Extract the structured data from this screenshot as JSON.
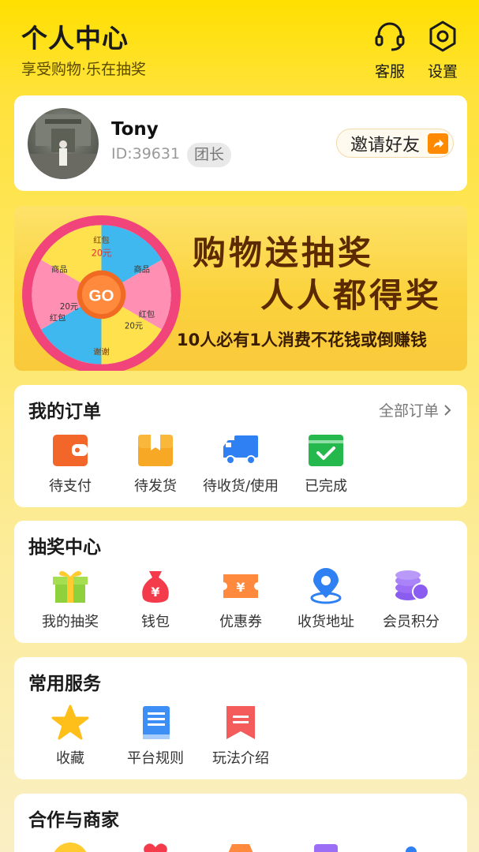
{
  "header": {
    "title": "个人中心",
    "subtitle": "享受购物·乐在抽奖",
    "service_label": "客服",
    "settings_label": "设置"
  },
  "profile": {
    "name": "Tony",
    "id_text": "ID:39631",
    "role_badge": "团长",
    "invite_label": "邀请好友"
  },
  "banner": {
    "headline_1": "购物送抽奖",
    "headline_2": "人人都得奖",
    "subline": "10人必有1人消费不花钱或倒赚钱",
    "wheel_center": "GO",
    "wheel_segments": [
      "红包",
      "20元",
      "商品",
      "红包",
      "20元",
      "谢谢",
      "红包",
      "20元",
      "商品"
    ]
  },
  "orders": {
    "title": "我的订单",
    "all_label": "全部订单",
    "items": [
      {
        "label": "待支付",
        "icon": "wallet-icon",
        "color": "#f2662a"
      },
      {
        "label": "待发货",
        "icon": "box-icon",
        "color": "#f7a825"
      },
      {
        "label": "待收货/使用",
        "icon": "truck-icon",
        "color": "#2f80f2"
      },
      {
        "label": "已完成",
        "icon": "check-card-icon",
        "color": "#25b84c"
      }
    ]
  },
  "lottery": {
    "title": "抽奖中心",
    "items": [
      {
        "label": "我的抽奖",
        "icon": "gift-icon"
      },
      {
        "label": "钱包",
        "icon": "money-bag-icon"
      },
      {
        "label": "优惠券",
        "icon": "coupon-icon"
      },
      {
        "label": "收货地址",
        "icon": "location-icon"
      },
      {
        "label": "会员积分",
        "icon": "coins-icon"
      }
    ]
  },
  "services": {
    "title": "常用服务",
    "items": [
      {
        "label": "收藏",
        "icon": "star-icon"
      },
      {
        "label": "平台规则",
        "icon": "book-icon"
      },
      {
        "label": "玩法介绍",
        "icon": "bookmark-icon"
      }
    ]
  },
  "partners": {
    "title": "合作与商家"
  },
  "colors": {
    "header_yellow": "#ffe000",
    "accent_orange": "#ff8a00"
  }
}
